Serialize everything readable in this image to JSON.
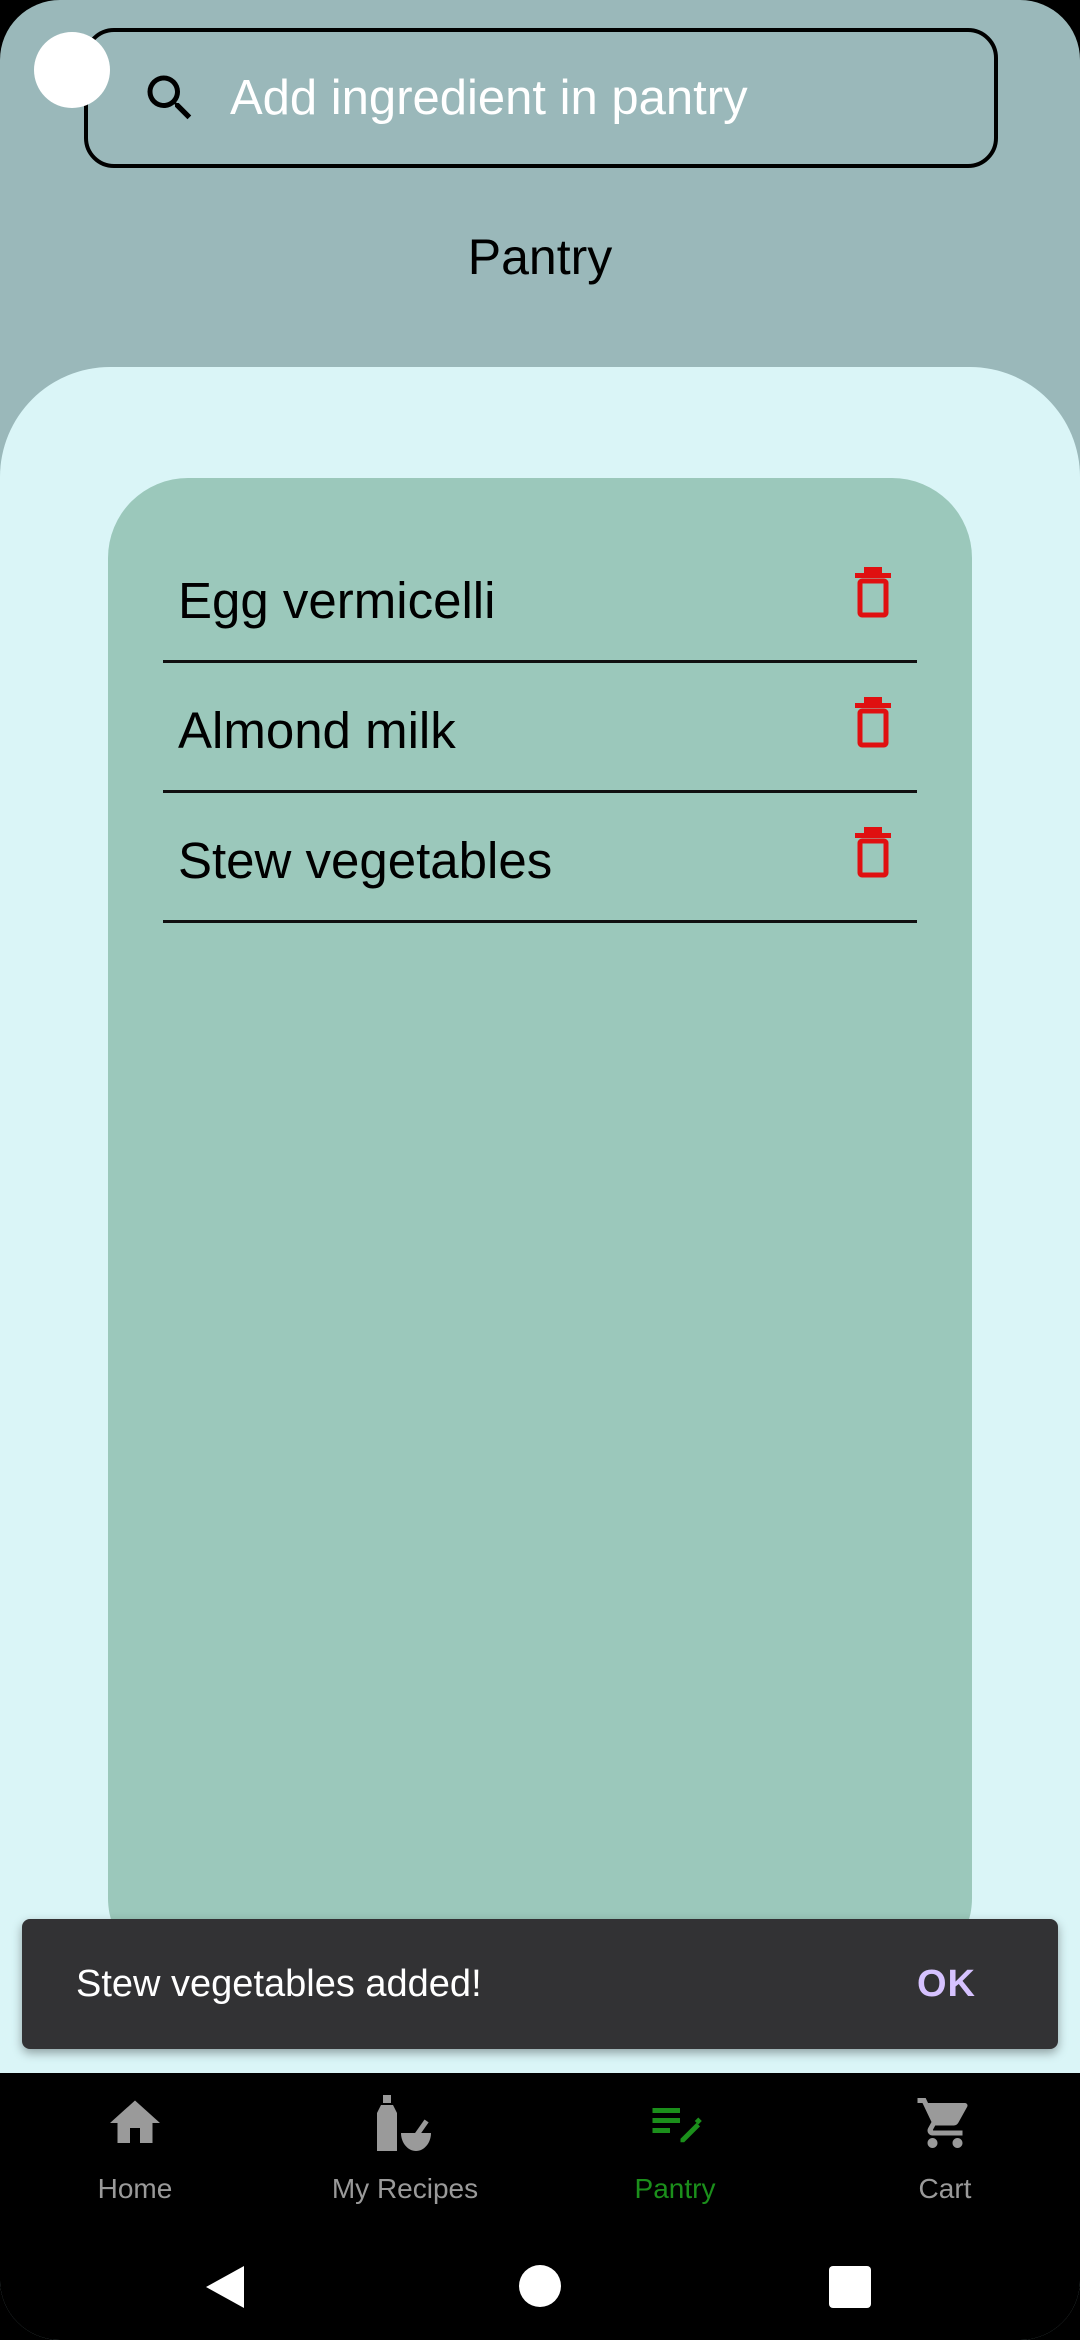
{
  "search": {
    "placeholder": "Add ingredient in pantry"
  },
  "page": {
    "title": "Pantry"
  },
  "pantry": {
    "items": [
      {
        "label": "Egg vermicelli"
      },
      {
        "label": "Almond milk"
      },
      {
        "label": "Stew vegetables"
      }
    ]
  },
  "snackbar": {
    "message": "Stew vegetables added!",
    "action": "OK"
  },
  "nav": {
    "items": [
      {
        "label": "Home",
        "icon": "home-icon"
      },
      {
        "label": "My Recipes",
        "icon": "recipes-icon"
      },
      {
        "label": "Pantry",
        "icon": "pantry-edit-icon",
        "active": true
      },
      {
        "label": "Cart",
        "icon": "cart-icon"
      }
    ]
  },
  "colors": {
    "header_bg": "#9ab8ba",
    "content_bg": "#daf5f7",
    "card_bg": "#9bc8bb",
    "delete_red": "#e01010",
    "active_nav": "#1b8f1b",
    "snackbar_bg": "#323234",
    "snackbar_action": "#d6c2ff"
  }
}
